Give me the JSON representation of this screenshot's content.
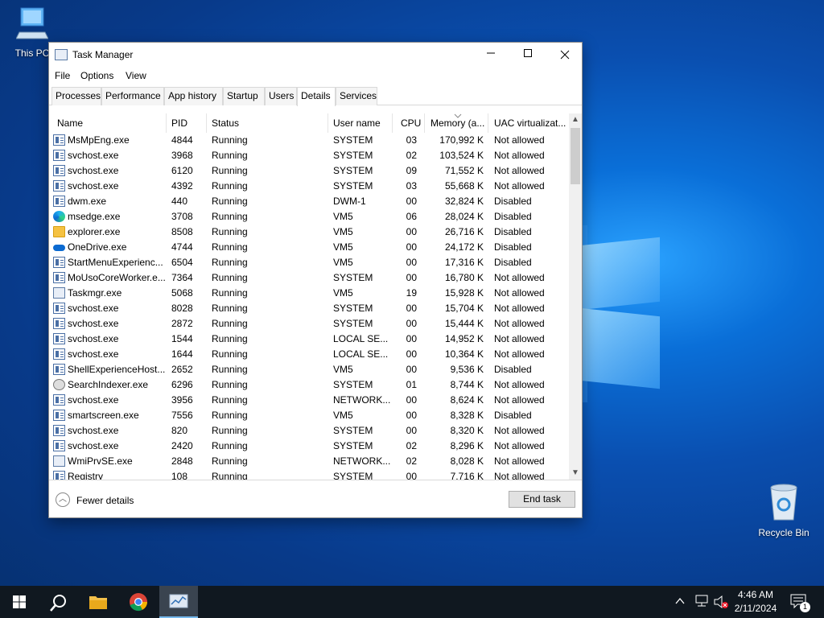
{
  "desktop": {
    "icons": [
      {
        "label": "This PC"
      },
      {
        "label": "Recycle Bin"
      }
    ]
  },
  "window": {
    "title": "Task Manager",
    "menu": [
      "File",
      "Options",
      "View"
    ],
    "tabs": [
      "Processes",
      "Performance",
      "App history",
      "Startup",
      "Users",
      "Details",
      "Services"
    ],
    "active_tab": "Details",
    "columns": [
      "Name",
      "PID",
      "Status",
      "User name",
      "CPU",
      "Memory (a...",
      "UAC virtualizat..."
    ],
    "rows": [
      {
        "icon": "generic-process-icon",
        "name": "MsMpEng.exe",
        "pid": "4844",
        "status": "Running",
        "user": "SYSTEM",
        "cpu": "03",
        "mem": "170,992 K",
        "uac": "Not allowed"
      },
      {
        "icon": "generic-process-icon",
        "name": "svchost.exe",
        "pid": "3968",
        "status": "Running",
        "user": "SYSTEM",
        "cpu": "02",
        "mem": "103,524 K",
        "uac": "Not allowed"
      },
      {
        "icon": "generic-process-icon",
        "name": "svchost.exe",
        "pid": "6120",
        "status": "Running",
        "user": "SYSTEM",
        "cpu": "09",
        "mem": "71,552 K",
        "uac": "Not allowed"
      },
      {
        "icon": "generic-process-icon",
        "name": "svchost.exe",
        "pid": "4392",
        "status": "Running",
        "user": "SYSTEM",
        "cpu": "03",
        "mem": "55,668 K",
        "uac": "Not allowed"
      },
      {
        "icon": "generic-process-icon",
        "name": "dwm.exe",
        "pid": "440",
        "status": "Running",
        "user": "DWM-1",
        "cpu": "00",
        "mem": "32,824 K",
        "uac": "Disabled"
      },
      {
        "icon": "edge-icon",
        "name": "msedge.exe",
        "pid": "3708",
        "status": "Running",
        "user": "VM5",
        "cpu": "06",
        "mem": "28,024 K",
        "uac": "Disabled"
      },
      {
        "icon": "folder-icon",
        "name": "explorer.exe",
        "pid": "8508",
        "status": "Running",
        "user": "VM5",
        "cpu": "00",
        "mem": "26,716 K",
        "uac": "Disabled"
      },
      {
        "icon": "onedrive-icon",
        "name": "OneDrive.exe",
        "pid": "4744",
        "status": "Running",
        "user": "VM5",
        "cpu": "00",
        "mem": "24,172 K",
        "uac": "Disabled"
      },
      {
        "icon": "generic-process-icon",
        "name": "StartMenuExperienc...",
        "pid": "6504",
        "status": "Running",
        "user": "VM5",
        "cpu": "00",
        "mem": "17,316 K",
        "uac": "Disabled"
      },
      {
        "icon": "generic-process-icon",
        "name": "MoUsoCoreWorker.e...",
        "pid": "7364",
        "status": "Running",
        "user": "SYSTEM",
        "cpu": "00",
        "mem": "16,780 K",
        "uac": "Not allowed"
      },
      {
        "icon": "taskmgr-icon",
        "name": "Taskmgr.exe",
        "pid": "5068",
        "status": "Running",
        "user": "VM5",
        "cpu": "19",
        "mem": "15,928 K",
        "uac": "Not allowed"
      },
      {
        "icon": "generic-process-icon",
        "name": "svchost.exe",
        "pid": "8028",
        "status": "Running",
        "user": "SYSTEM",
        "cpu": "00",
        "mem": "15,704 K",
        "uac": "Not allowed"
      },
      {
        "icon": "generic-process-icon",
        "name": "svchost.exe",
        "pid": "2872",
        "status": "Running",
        "user": "SYSTEM",
        "cpu": "00",
        "mem": "15,444 K",
        "uac": "Not allowed"
      },
      {
        "icon": "generic-process-icon",
        "name": "svchost.exe",
        "pid": "1544",
        "status": "Running",
        "user": "LOCAL SE...",
        "cpu": "00",
        "mem": "14,952 K",
        "uac": "Not allowed"
      },
      {
        "icon": "generic-process-icon",
        "name": "svchost.exe",
        "pid": "1644",
        "status": "Running",
        "user": "LOCAL SE...",
        "cpu": "00",
        "mem": "10,364 K",
        "uac": "Not allowed"
      },
      {
        "icon": "generic-process-icon",
        "name": "ShellExperienceHost....",
        "pid": "2652",
        "status": "Running",
        "user": "VM5",
        "cpu": "00",
        "mem": "9,536 K",
        "uac": "Disabled"
      },
      {
        "icon": "search-indexer-icon",
        "name": "SearchIndexer.exe",
        "pid": "6296",
        "status": "Running",
        "user": "SYSTEM",
        "cpu": "01",
        "mem": "8,744 K",
        "uac": "Not allowed"
      },
      {
        "icon": "generic-process-icon",
        "name": "svchost.exe",
        "pid": "3956",
        "status": "Running",
        "user": "NETWORK...",
        "cpu": "00",
        "mem": "8,624 K",
        "uac": "Not allowed"
      },
      {
        "icon": "generic-process-icon",
        "name": "smartscreen.exe",
        "pid": "7556",
        "status": "Running",
        "user": "VM5",
        "cpu": "00",
        "mem": "8,328 K",
        "uac": "Disabled"
      },
      {
        "icon": "generic-process-icon",
        "name": "svchost.exe",
        "pid": "820",
        "status": "Running",
        "user": "SYSTEM",
        "cpu": "00",
        "mem": "8,320 K",
        "uac": "Not allowed"
      },
      {
        "icon": "generic-process-icon",
        "name": "svchost.exe",
        "pid": "2420",
        "status": "Running",
        "user": "SYSTEM",
        "cpu": "02",
        "mem": "8,296 K",
        "uac": "Not allowed"
      },
      {
        "icon": "taskmgr-icon",
        "name": "WmiPrvSE.exe",
        "pid": "2848",
        "status": "Running",
        "user": "NETWORK...",
        "cpu": "02",
        "mem": "8,028 K",
        "uac": "Not allowed"
      },
      {
        "icon": "generic-process-icon",
        "name": "Registry",
        "pid": "108",
        "status": "Running",
        "user": "SYSTEM",
        "cpu": "00",
        "mem": "7,716 K",
        "uac": "Not allowed"
      }
    ],
    "fewer_details": "Fewer details",
    "end_task": "End task"
  },
  "taskbar": {
    "time": "4:46 AM",
    "date": "2/11/2024",
    "notification_count": "1"
  }
}
